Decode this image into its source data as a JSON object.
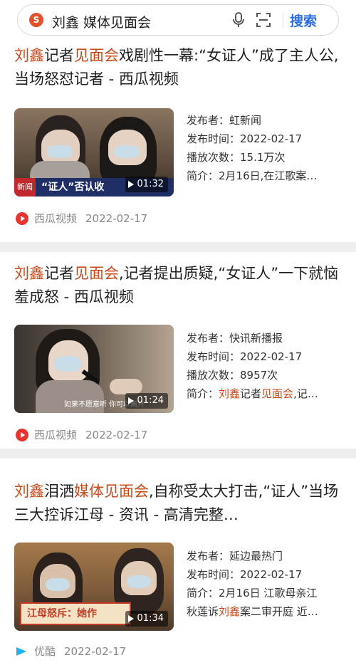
{
  "search": {
    "engine_logo": "S",
    "query": "刘鑫 媒体见面会",
    "button_label": "搜索"
  },
  "colors": {
    "highlight": "#c94a1b",
    "accent": "#2b6de5",
    "xigua_red": "#e8332e"
  },
  "results": [
    {
      "title_parts": [
        {
          "text": "刘鑫",
          "hl": true
        },
        {
          "text": "记者",
          "hl": false
        },
        {
          "text": "见面会",
          "hl": true
        },
        {
          "text": "戏剧性一幕:“女证人”成了主人公,当场怒怼记者 - 西瓜视频",
          "hl": false
        }
      ],
      "thumb_overlay": "“证人”否认收",
      "thumb_badge": "新闻",
      "duration": "01:32",
      "publisher": "发布者：虹新闻",
      "publish_time": "发布时间：2022-02-17",
      "plays": "播放次数：15.1万次",
      "summary_parts": [
        {
          "text": "简介：2月16日,在江歌案…",
          "hl": false
        }
      ],
      "source_name": "西瓜视频",
      "source_icon": "xigua-icon",
      "date": "2022-02-17"
    },
    {
      "title_parts": [
        {
          "text": "刘鑫",
          "hl": true
        },
        {
          "text": "记者",
          "hl": false
        },
        {
          "text": "见面会",
          "hl": true
        },
        {
          "text": ",记者提出质疑,“女证人”一下就恼羞成怒 - 西瓜视频",
          "hl": false
        }
      ],
      "thumb_overlay": "如果不愿意听  你可以离开",
      "duration": "01:24",
      "publisher": "发布者：快讯新播报",
      "publish_time": "发布时间：2022-02-17",
      "plays": "播放次数：8957次",
      "summary_parts": [
        {
          "text": "简介：",
          "hl": false
        },
        {
          "text": "刘鑫",
          "hl": true
        },
        {
          "text": "记者",
          "hl": false
        },
        {
          "text": "见面会",
          "hl": true
        },
        {
          "text": ",记…",
          "hl": false
        }
      ],
      "source_name": "西瓜视频",
      "source_icon": "xigua-icon",
      "date": "2022-02-17"
    },
    {
      "title_parts": [
        {
          "text": "刘鑫",
          "hl": true
        },
        {
          "text": "泪洒",
          "hl": false
        },
        {
          "text": "媒体见面会",
          "hl": true
        },
        {
          "text": ",自称受太大打击,“证人”当场三大控诉江母 - 资讯 - 高清完整…",
          "hl": false
        }
      ],
      "thumb_overlay": "江母怒斥：她作",
      "duration": "01:34",
      "publisher": "发布者：延边最热门",
      "publish_time": "发布时间：2022-02-17",
      "summary_line1": "简介：2月16日 江歌母亲江",
      "summary_parts": [
        {
          "text": "秋莲诉",
          "hl": false
        },
        {
          "text": "刘鑫",
          "hl": true
        },
        {
          "text": "案二审开庭 近…",
          "hl": false
        }
      ],
      "source_name": "优酷",
      "source_icon": "youku-icon",
      "date": "2022-02-17"
    }
  ]
}
